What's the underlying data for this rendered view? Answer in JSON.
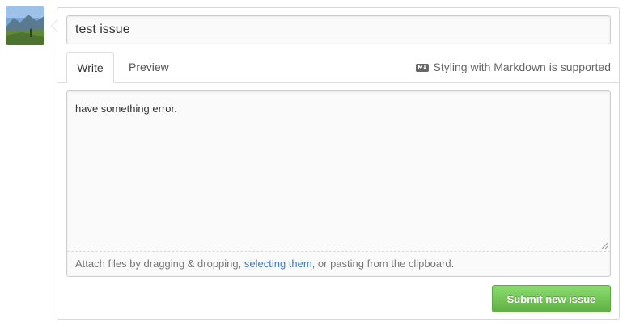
{
  "avatar": {
    "alt": "user avatar"
  },
  "form": {
    "title_value": "test issue",
    "tabs": [
      {
        "label": "Write",
        "active": true
      },
      {
        "label": "Preview",
        "active": false
      }
    ],
    "markdown_note": "Styling with Markdown is supported",
    "markdown_icon": "markdown-icon",
    "body_value": "have something error.",
    "drop_hint": {
      "before": "Attach files by dragging & dropping, ",
      "link": "selecting them",
      "after": ", or pasting from the clipboard."
    },
    "submit_label": "Submit new issue"
  },
  "colors": {
    "submit_green": "#60b044",
    "link_blue": "#4078c0",
    "border_gray": "#d8d8d8"
  }
}
